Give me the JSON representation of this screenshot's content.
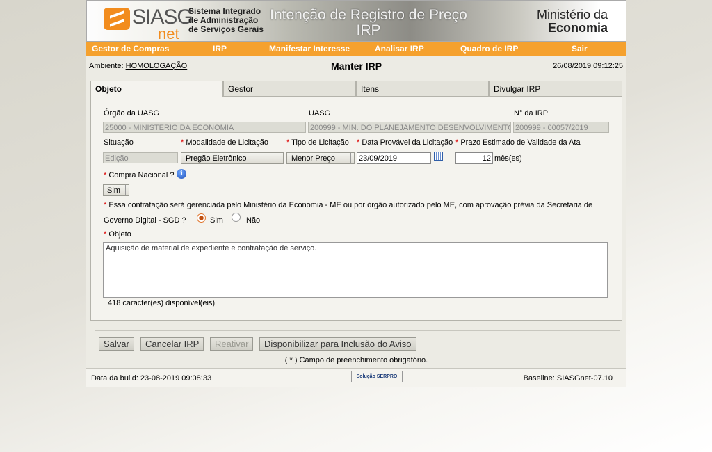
{
  "header": {
    "logo_text": "SIASG",
    "logo_suffix": "net",
    "system_name": "Sistema Integrado de Administração de Serviços Gerais",
    "banner_title": "Intenção de Registro de Preço IRP",
    "ministry_line1": "Ministério da",
    "ministry_line2": "Economia"
  },
  "nav": [
    "Gestor de Compras",
    "IRP",
    "Manifestar Interesse",
    "Analisar IRP",
    "Quadro de IRP",
    "Sair"
  ],
  "titlebar": {
    "env_label": "Ambiente:",
    "env_value": "HOMOLOGAÇÃO",
    "page_title": "Manter IRP",
    "datetime": "26/08/2019 09:12:25"
  },
  "tabs": [
    "Objeto",
    "Gestor",
    "Itens",
    "Divulgar IRP"
  ],
  "form": {
    "orgao_label": "Órgão da UASG",
    "orgao_value": "25000 - MINISTERIO DA ECONOMIA",
    "uasg_label": "UASG",
    "uasg_value": "200999 - MIN. DO PLANEJAMENTO DESENVOLVIMENTO",
    "irp_num_label": "N° da IRP",
    "irp_num_value": "200999 - 00057/2019",
    "situacao_label": "Situação",
    "situacao_value": "Edição",
    "modalidade_label": "Modalidade de Licitação",
    "modalidade_value": "Pregão Eletrônico",
    "tipo_label": "Tipo de Licitação",
    "tipo_value": "Menor Preço",
    "data_label": "Data Provável da Licitação",
    "data_value": "23/09/2019",
    "prazo_label": "Prazo Estimado de Validade da Ata",
    "prazo_value": "12",
    "prazo_unit": "mês(es)",
    "compra_nacional_label": "Compra Nacional ?",
    "compra_nacional_value": "Sim",
    "gerenciada_line1": "Essa contratação será gerenciada pelo Ministério da Economia - ME ou por órgão autorizado pelo ME, com aprovação prévia da Secretaria de",
    "gerenciada_line2": "Governo Digital - SGD ?",
    "radio_sim": "Sim",
    "radio_nao": "Não",
    "objeto_label": "Objeto",
    "objeto_value": "Aquisição de material de expediente e contratação de serviço.",
    "chars_available": "418 caracter(es) disponível(eis)",
    "required_mark": "*"
  },
  "buttons": {
    "salvar": "Salvar",
    "cancelar": "Cancelar IRP",
    "reativar": "Reativar",
    "disponibilizar": "Disponibilizar para Inclusão do Aviso"
  },
  "required_note": "( * ) Campo de preenchimento obrigatório.",
  "footer": {
    "build": "Data da build: 23-08-2019 09:08:33",
    "serpro": "Solução SERPRO",
    "baseline": "Baseline: SIASGnet-07.10"
  },
  "colors": {
    "accent": "#f5a12e",
    "required": "#dd0000"
  },
  "icons": {
    "info": "info-icon",
    "calendar": "calendar-icon"
  }
}
